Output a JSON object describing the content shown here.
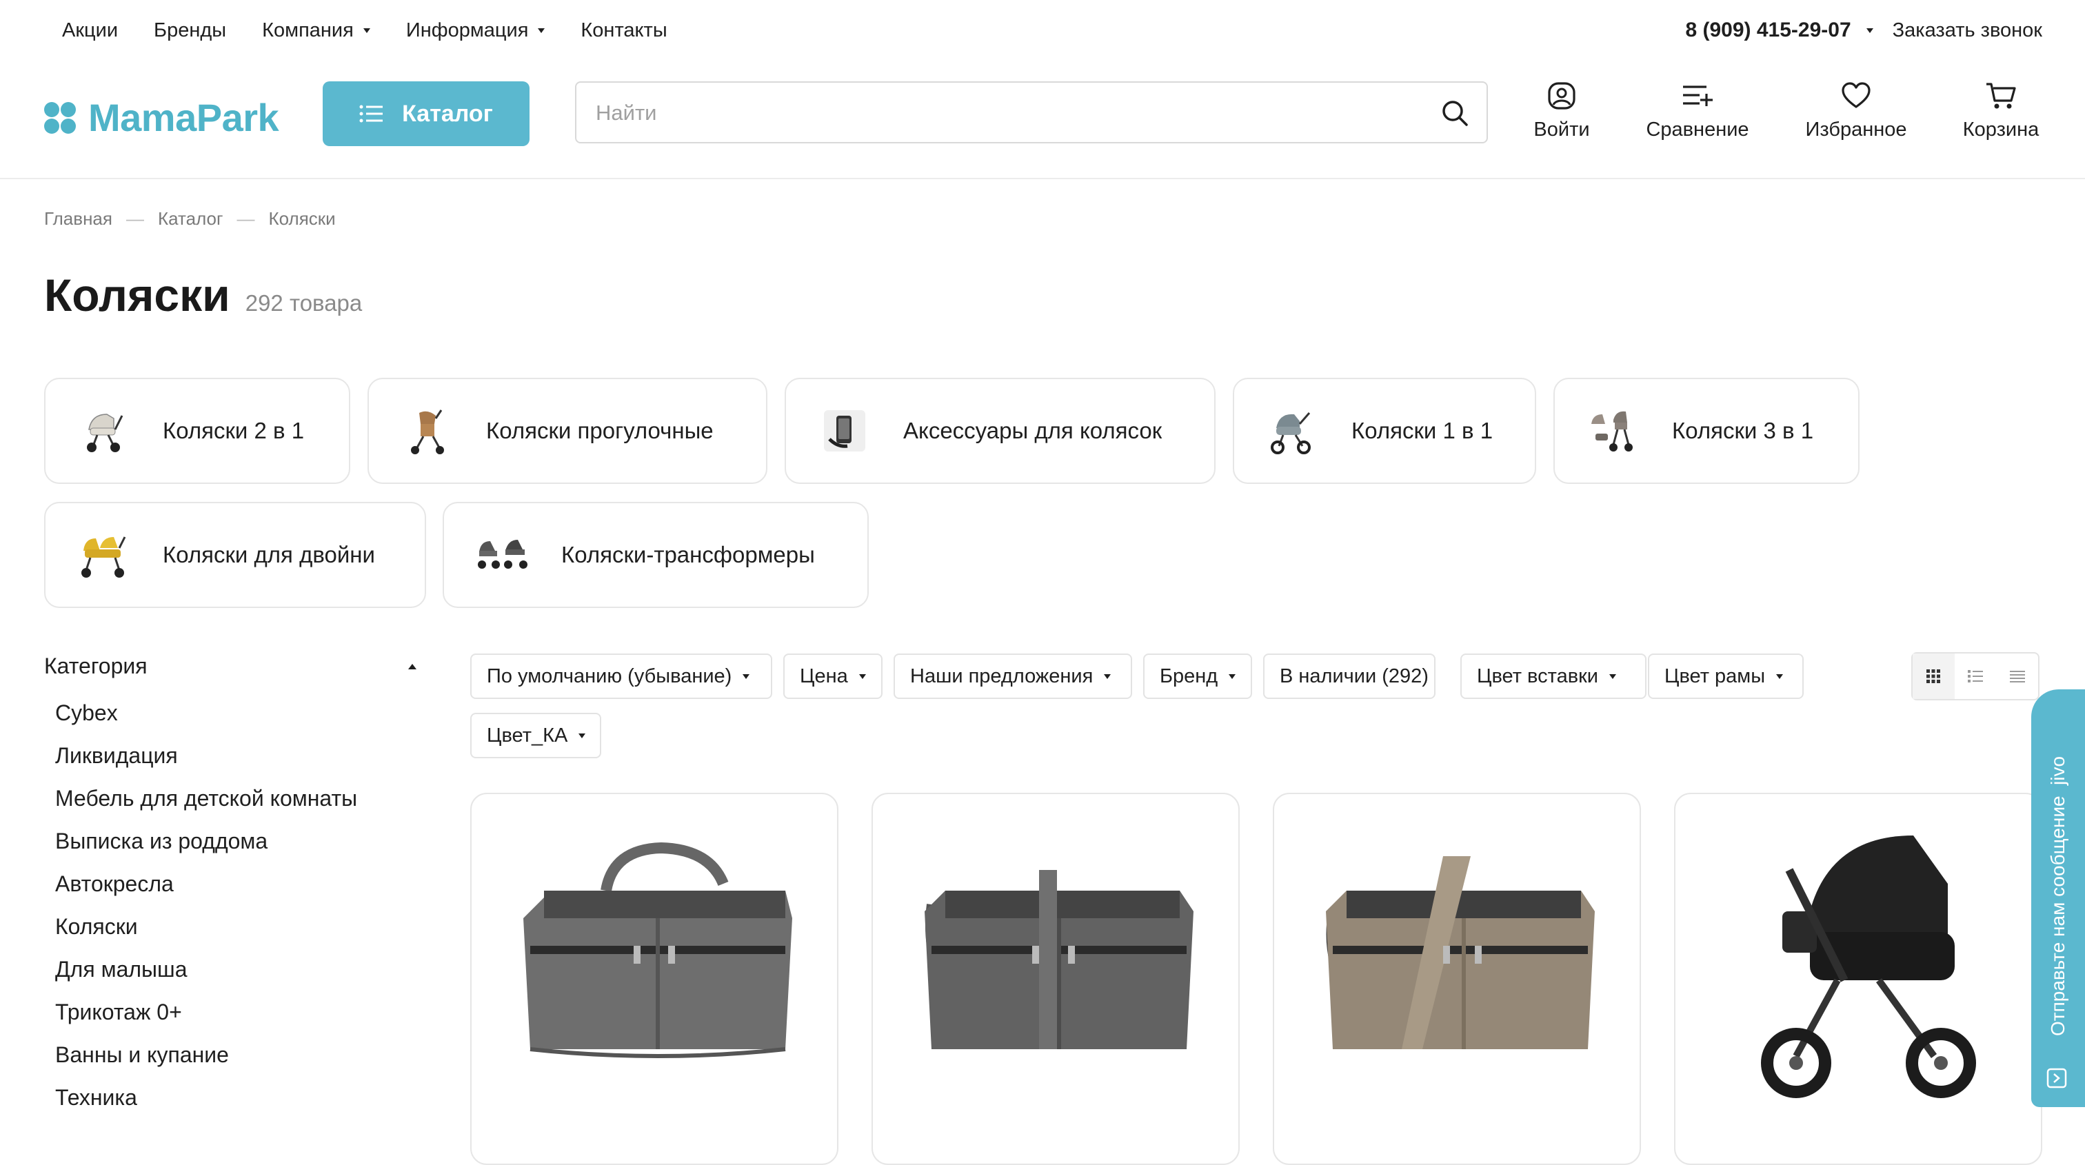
{
  "topnav": {
    "links": [
      {
        "label": "Акции",
        "dropdown": false
      },
      {
        "label": "Бренды",
        "dropdown": false
      },
      {
        "label": "Компания",
        "dropdown": true
      },
      {
        "label": "Информация",
        "dropdown": true
      },
      {
        "label": "Контакты",
        "dropdown": false
      }
    ],
    "phone": "8 (909) 415-29-07",
    "callback": "Заказать звонок"
  },
  "header": {
    "logo": "MamaPark",
    "catalog_button": "Каталог",
    "search_placeholder": "Найти",
    "icons": {
      "login": "Войти",
      "compare": "Сравнение",
      "favorites": "Избранное",
      "cart": "Корзина"
    }
  },
  "breadcrumb": [
    "Главная",
    "Каталог",
    "Коляски"
  ],
  "page": {
    "title": "Коляски",
    "count": "292 товара"
  },
  "subcategories": [
    {
      "label": "Коляски 2 в 1",
      "icon": "stroller-2in1-icon"
    },
    {
      "label": "Коляски прогулочные",
      "icon": "stroller-walking-icon"
    },
    {
      "label": "Аксессуары для колясок",
      "icon": "phone-holder-icon"
    },
    {
      "label": "Коляски 1 в 1",
      "icon": "stroller-1in1-icon"
    },
    {
      "label": "Коляски 3 в 1",
      "icon": "stroller-3in1-icon"
    },
    {
      "label": "Коляски для двойни",
      "icon": "stroller-twins-icon"
    },
    {
      "label": "Коляски-трансформеры",
      "icon": "stroller-transformer-icon"
    }
  ],
  "sidebar": {
    "heading": "Категория",
    "items": [
      "Cybex",
      "Ликвидация",
      "Мебель для детской комнаты",
      "Выписка из роддома",
      "Автокресла",
      "Коляски",
      "Для малыша",
      "Трикотаж 0+",
      "Ванны и купание",
      "Техника"
    ]
  },
  "filters": [
    {
      "label": "По умолчанию (убывание)",
      "dropdown": true
    },
    {
      "label": "Цена",
      "dropdown": true
    },
    {
      "label": "Наши предложения",
      "dropdown": true
    },
    {
      "label": "Бренд",
      "dropdown": true
    },
    {
      "label": "В наличии (292)",
      "dropdown": false
    },
    {
      "label": "Цвет вставки",
      "dropdown": true
    },
    {
      "label": "Цвет рамы",
      "dropdown": true
    },
    {
      "label": "Цвет_КА",
      "dropdown": true
    }
  ],
  "products": [
    {
      "image": "grey-bag",
      "color": "#6f6f6f"
    },
    {
      "image": "grey-bag",
      "color": "#5e5e5e"
    },
    {
      "image": "beige-bag",
      "color": "#8e8272"
    },
    {
      "image": "black-stroller",
      "color": "#1e1e1e"
    }
  ],
  "chat_widget": {
    "label": "Отправьте нам сообщение",
    "brand": "jivo"
  },
  "colors": {
    "accent": "#5bb8cf",
    "logo": "#4fb3c8",
    "text": "#1f1f1f",
    "muted": "#8a8a8a"
  }
}
